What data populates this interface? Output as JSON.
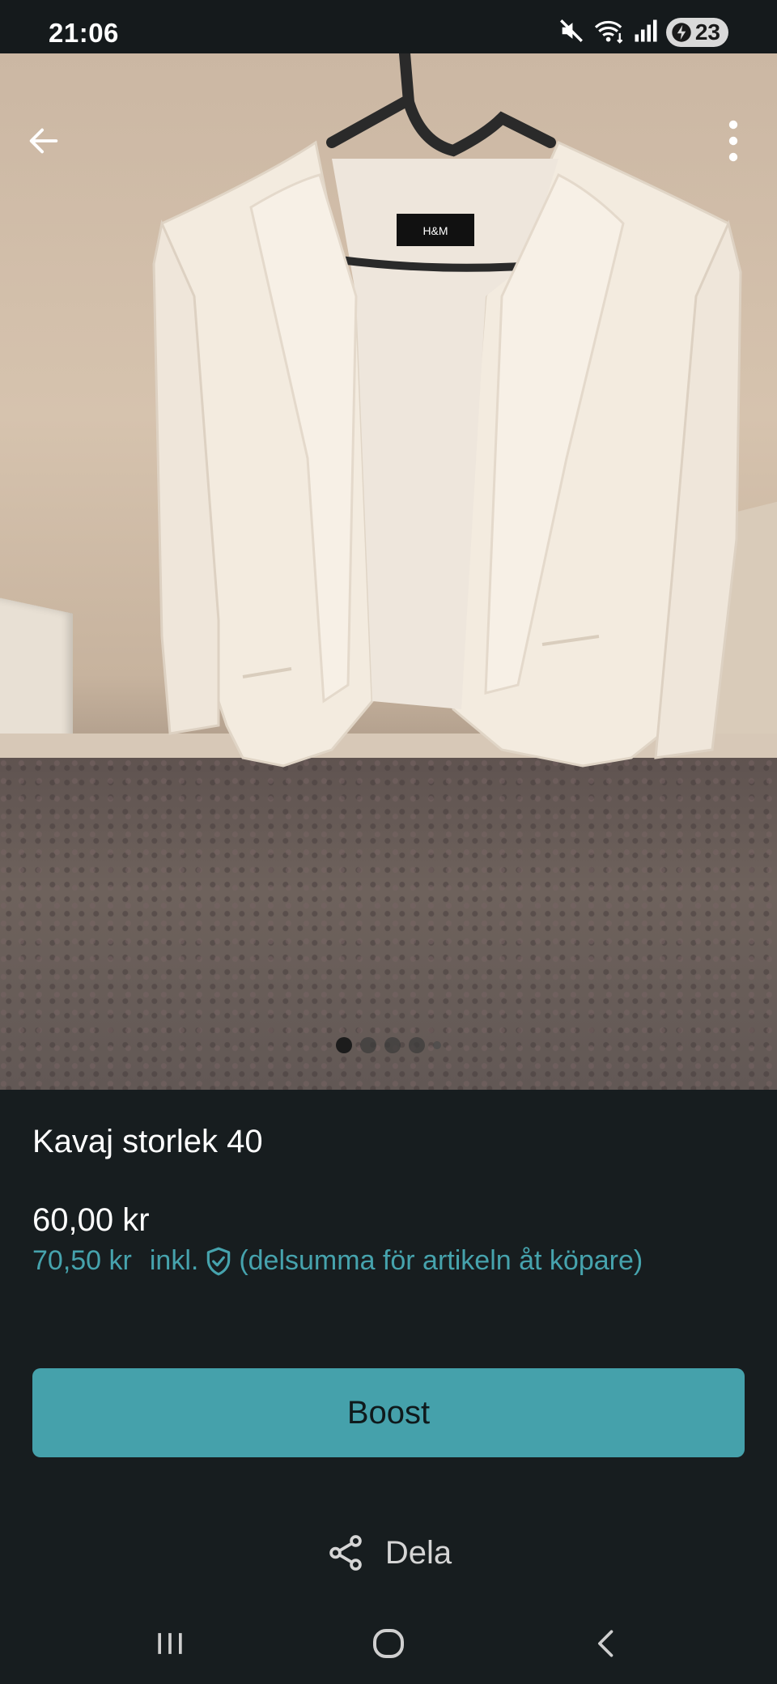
{
  "status_bar": {
    "time": "21:06",
    "battery": "23"
  },
  "listing": {
    "title": "Kavaj storlek 40",
    "price": "60,00 kr",
    "price_incl_amount": "70,50 kr",
    "price_incl_word": "inkl.",
    "price_incl_note": "(delsumma för artikeln åt köpare)"
  },
  "actions": {
    "boost_label": "Boost",
    "share_label": "Dela"
  },
  "gallery": {
    "image_count": 5,
    "active_index": 0
  },
  "icons": {
    "back": "arrow-left-icon",
    "more": "more-vertical-icon",
    "shield": "shield-check-icon",
    "share": "share-icon",
    "recent": "recent-apps-icon",
    "home": "home-icon",
    "sys_back": "chevron-left-icon"
  },
  "colors": {
    "accent": "#45a1ab",
    "background": "#171d1f",
    "link_text": "#46a3ad"
  }
}
